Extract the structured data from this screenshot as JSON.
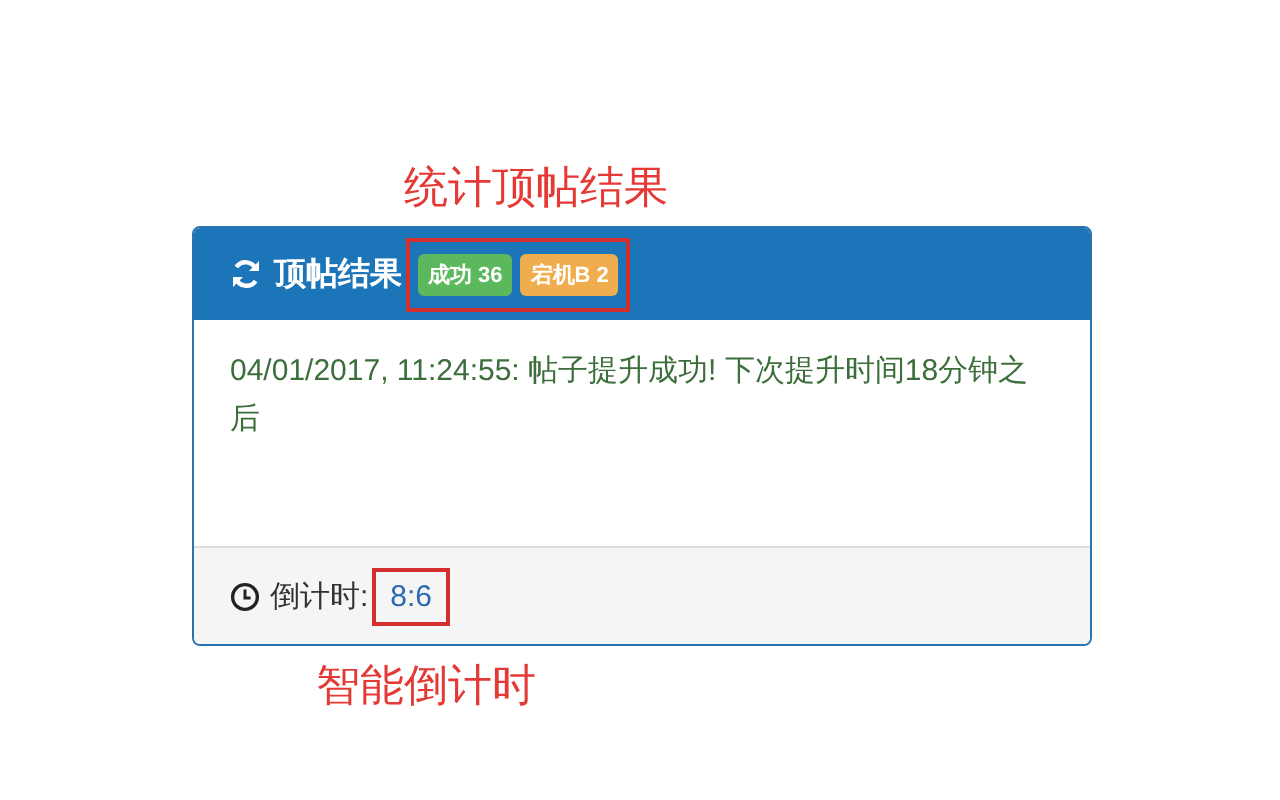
{
  "annotations": {
    "top": "统计顶帖结果",
    "bottom": "智能倒计时"
  },
  "panel": {
    "title": "顶帖结果",
    "badges": [
      {
        "label": "成功 36",
        "color": "#5cb85c"
      },
      {
        "label": "宕机B 2",
        "color": "#f0ad4e"
      }
    ],
    "message": "04/01/2017, 11:24:55: 帖子提升成功! 下次提升时间18分钟之后",
    "countdown_label": "倒计时:",
    "countdown_value": "8:6"
  }
}
